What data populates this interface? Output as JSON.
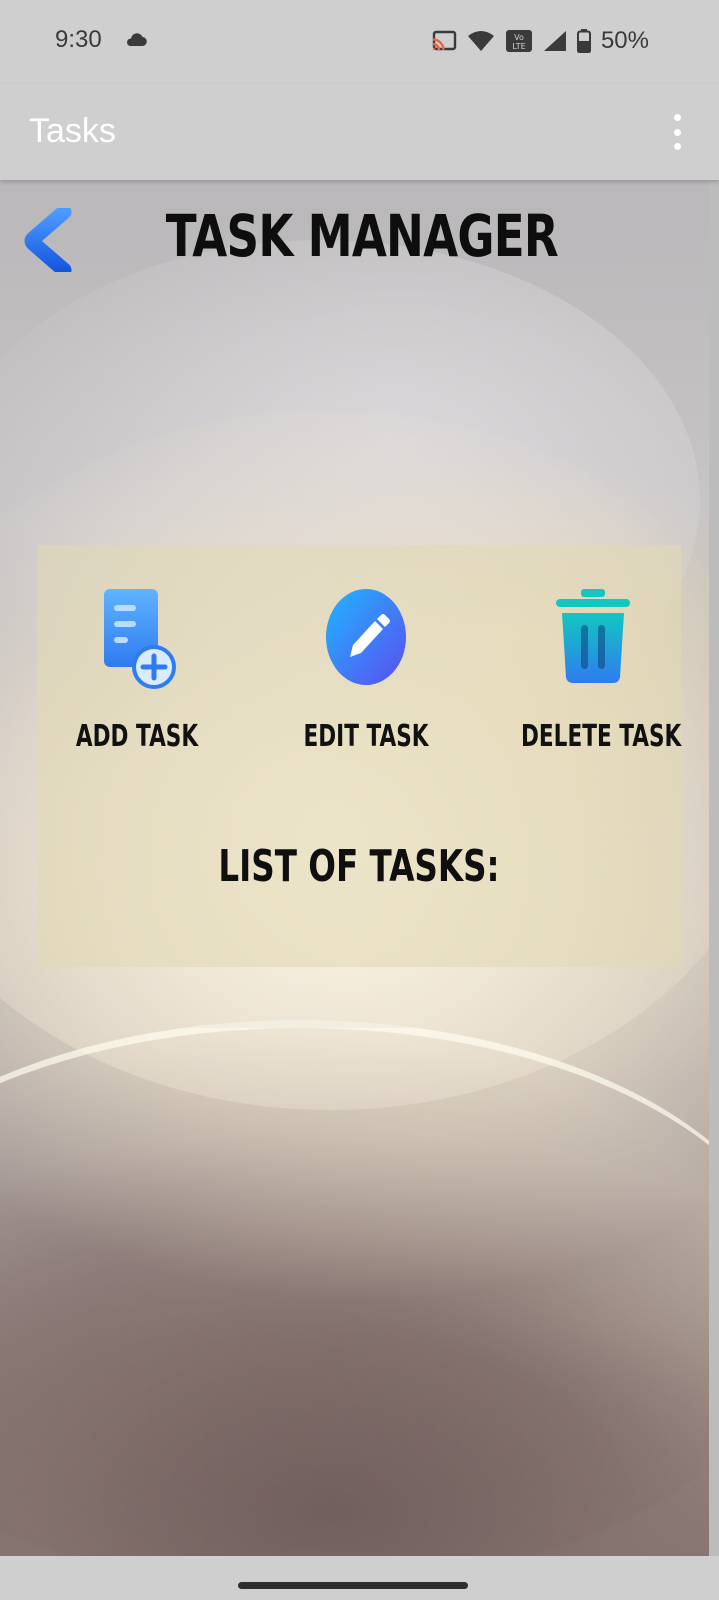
{
  "status_bar": {
    "time": "9:30",
    "battery_percent": "50%",
    "icons": [
      "cloud-icon",
      "cast-icon",
      "wifi-icon",
      "volte-icon",
      "cell-signal-icon",
      "battery-icon"
    ]
  },
  "app_bar": {
    "title": "Tasks",
    "menu_icon": "more-vert-icon"
  },
  "header": {
    "back_icon": "chevron-left-icon",
    "title": "TASK MANAGER"
  },
  "actions": [
    {
      "label": "ADD TASK",
      "icon": "add-document-icon"
    },
    {
      "label": "EDIT TASK",
      "icon": "edit-pencil-icon"
    },
    {
      "label": "DELETE TASK",
      "icon": "trash-icon"
    }
  ],
  "list": {
    "heading": "LIST OF TASKS:"
  },
  "colors": {
    "accent_blue": "#2f7bf0",
    "teal": "#12c4c4",
    "panel_tint": "#e1d8b2"
  }
}
